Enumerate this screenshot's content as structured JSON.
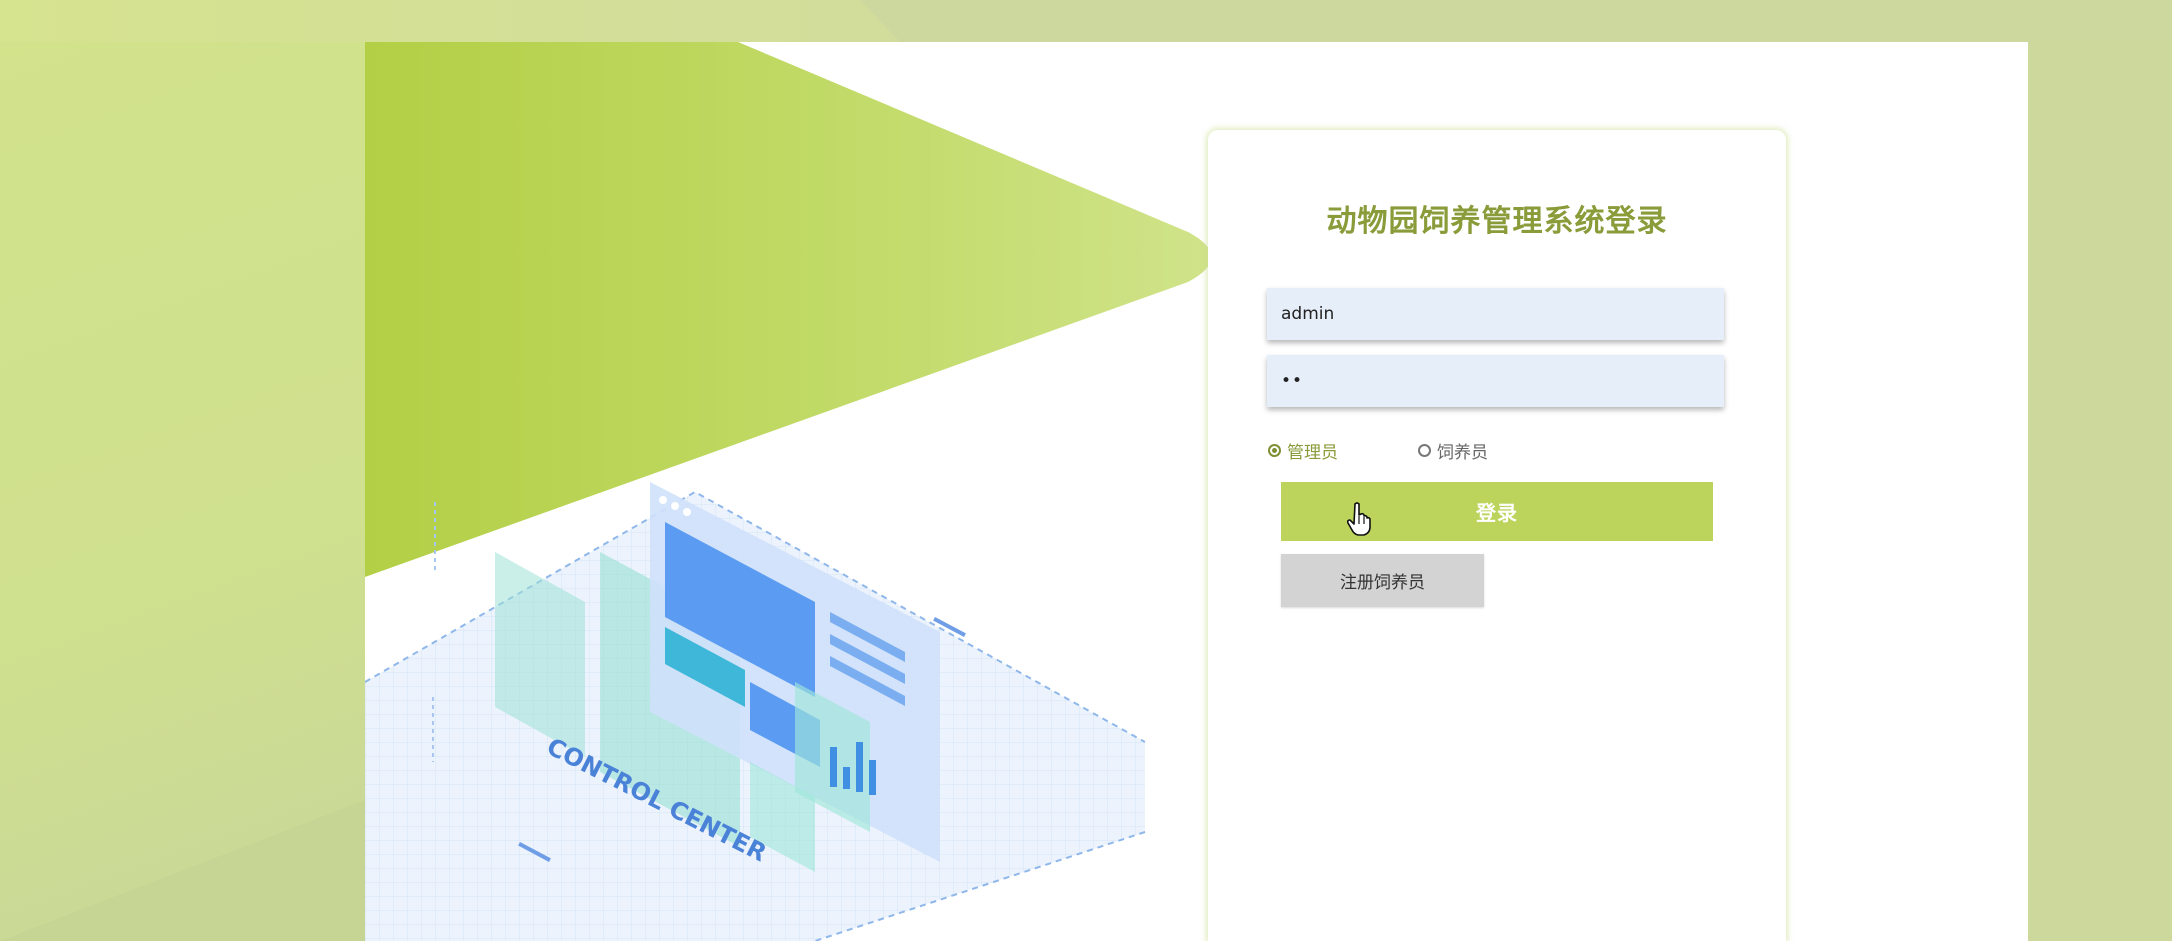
{
  "login": {
    "title": "动物园饲养管理系统登录",
    "username_value": "admin",
    "password_value": "••",
    "roles": [
      {
        "label": "管理员",
        "selected": true
      },
      {
        "label": "饲养员",
        "selected": false
      }
    ],
    "login_label": "登录",
    "register_label": "注册饲养员"
  },
  "illustration": {
    "caption": "CONTROL CENTER"
  },
  "colors": {
    "accent": "#bcd45c",
    "title": "#8a9b3a",
    "background": "#cdd99c"
  },
  "icons": [
    "hand-pointer-cursor-icon"
  ]
}
